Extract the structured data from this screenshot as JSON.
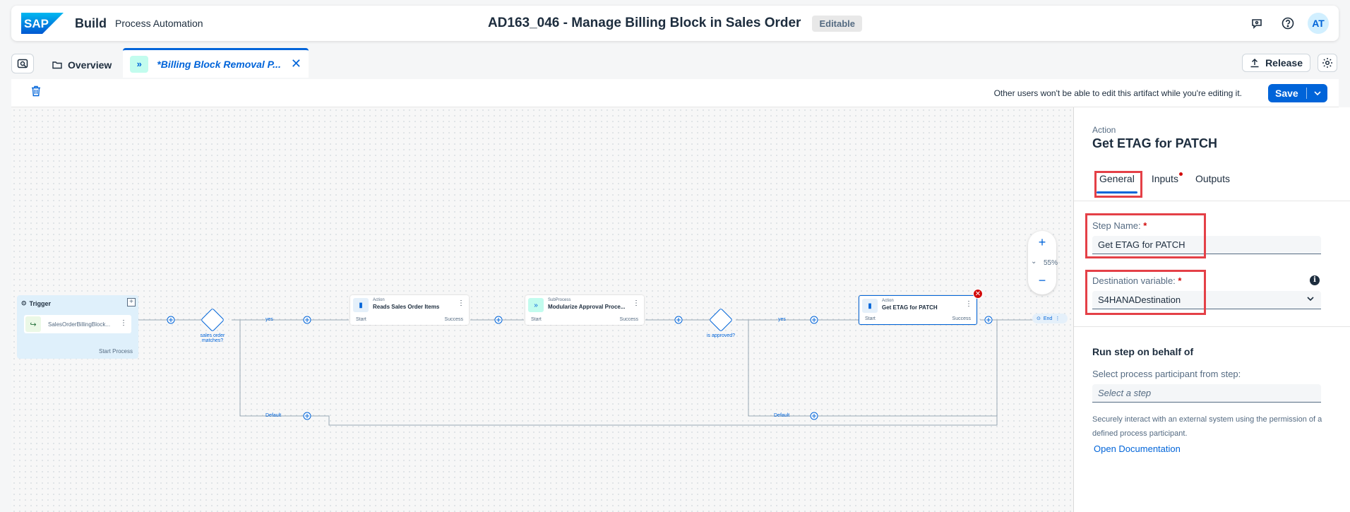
{
  "shell": {
    "logo_text": "SAP",
    "product": "Build",
    "subproduct": "Process Automation",
    "project_title": "AD163_046 - Manage Billing Block in Sales Order",
    "status_badge": "Editable",
    "avatar_initials": "AT"
  },
  "tabs": {
    "overview_label": "Overview",
    "active_label": "*Billing Block Removal P..."
  },
  "actions": {
    "release_label": "Release",
    "save_label": "Save",
    "lock_message": "Other users won't be able to edit this artifact while you're editing it."
  },
  "canvas": {
    "zoom_level": "55%",
    "trigger": {
      "header": "Trigger",
      "item": "SalesOrderBillingBlock...",
      "footer": "Start Process"
    },
    "nodes": [
      {
        "kind": "Action",
        "name": "Reads Sales Order Items",
        "start": "Start",
        "success": "Success"
      },
      {
        "kind": "SubProcess",
        "name": "Modularize Approval Proce...",
        "start": "Start",
        "success": "Success"
      },
      {
        "kind": "Action",
        "name": "Get ETAG for PATCH",
        "start": "Start",
        "success": "Success"
      }
    ],
    "gates": [
      {
        "label": "sales order matches?"
      },
      {
        "label": "is approved?"
      }
    ],
    "wire_labels": {
      "yes1": "yes",
      "yes2": "yes",
      "default1": "Default",
      "default2": "Default"
    },
    "end_label": "End"
  },
  "panel": {
    "kind": "Action",
    "title": "Get ETAG for PATCH",
    "tabs": [
      "General",
      "Inputs",
      "Outputs"
    ],
    "step_name_label": "Step Name:",
    "step_name_value": "Get ETAG for PATCH",
    "destination_label": "Destination variable:",
    "destination_value": "S4HANADestination",
    "run_section": "Run step on behalf of",
    "participant_label": "Select process participant from step:",
    "participant_placeholder": "Select a step",
    "note": "Securely interact with an external system using the permission of a defined process participant.",
    "doc_link": "Open Documentation",
    "required_mark": "*"
  },
  "colors": {
    "accent": "#0064d9",
    "highlight": "#e44047",
    "error": "#d20a0a"
  }
}
